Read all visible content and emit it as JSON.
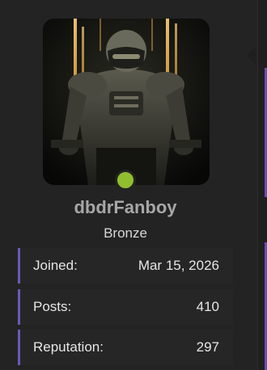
{
  "profile": {
    "username": "dbdrFanboy",
    "rank": "Bronze",
    "status_color": "#8fbf2e",
    "accent_color": "#6a5ab8"
  },
  "stats": [
    {
      "label": "Joined:",
      "value": "Mar 15, 2026"
    },
    {
      "label": "Posts:",
      "value": "410"
    },
    {
      "label": "Reputation:",
      "value": "297"
    }
  ]
}
